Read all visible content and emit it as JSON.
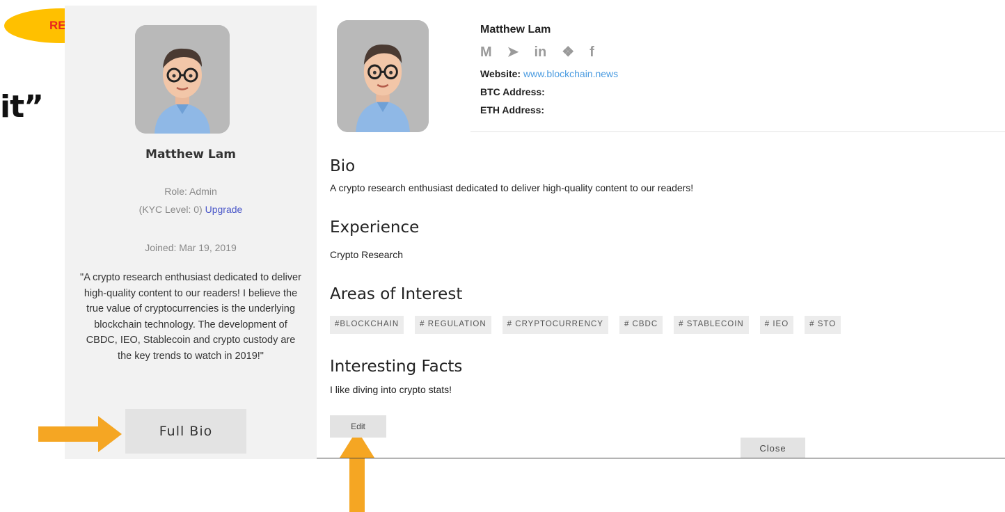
{
  "ref_label": "REF",
  "clipped_text": "it”",
  "left_card": {
    "name": "Matthew Lam",
    "role": "Role: Admin",
    "kyc_prefix": "(KYC Level: 0)",
    "upgrade_link": "Upgrade",
    "joined": "Joined: Mar 19, 2019",
    "quote": "\"A crypto research enthusiast dedicated to deliver high-quality content to our readers! I believe the true value of cryptocurrencies is the underlying blockchain technology. The development of CBDC, IEO, Stablecoin and crypto custody are the key trends to watch in 2019!\"",
    "full_bio_button": "Full Bio"
  },
  "profile": {
    "name": "Matthew Lam",
    "socials": [
      {
        "icon": "medium-icon",
        "glyph": "M"
      },
      {
        "icon": "telegram-icon",
        "glyph": "➤"
      },
      {
        "icon": "linkedin-icon",
        "glyph": "in"
      },
      {
        "icon": "twitter-icon",
        "glyph": "❖"
      },
      {
        "icon": "facebook-icon",
        "glyph": "f"
      }
    ],
    "website_label": "Website:",
    "website_value": "www.blockchain.news",
    "btc_label": "BTC Address:",
    "eth_label": "ETH Address:"
  },
  "sections": {
    "bio_title": "Bio",
    "bio_text": "A crypto research enthusiast dedicated to deliver high-quality content to our readers!",
    "experience_title": "Experience",
    "experience_text": "Crypto Research",
    "interests_title": "Areas of Interest",
    "tags": [
      "#BLOCKCHAIN",
      "# REGULATION",
      "# CRYPTOCURRENCY",
      "# CBDC",
      "# STABLECOIN",
      "# IEO",
      "# STO"
    ],
    "facts_title": "Interesting Facts",
    "facts_text": "I like diving into crypto stats!"
  },
  "buttons": {
    "edit": "Edit",
    "close": "Close"
  },
  "colors": {
    "badge": "#ffc000",
    "badge_text": "#e8281e",
    "arrow": "#f5a623",
    "link": "#4a9be0",
    "upgrade": "#4a57c9"
  }
}
